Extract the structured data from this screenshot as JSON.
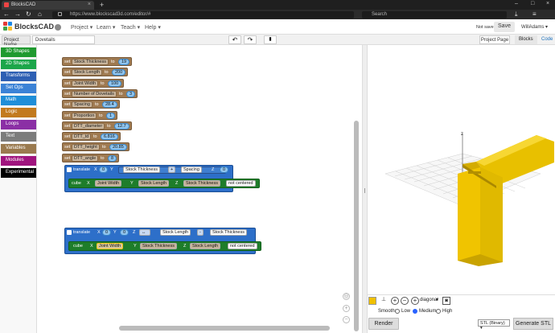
{
  "browser": {
    "tab_title": "BlocksCAD",
    "tab_close": "×",
    "new_tab": "+",
    "url": "https://www.blockscad3d.com/editor/#",
    "search_placeholder": "Search",
    "win_min": "–",
    "win_max": "□",
    "win_close": "×"
  },
  "header": {
    "brand": "BlocksCAD",
    "menu": [
      {
        "label": "Project ▾"
      },
      {
        "label": "Learn ▾"
      },
      {
        "label": "Teach ▾"
      },
      {
        "label": "Help ▾"
      }
    ],
    "status": "Not saved",
    "save_label": "Save",
    "user": "WillAdams ▾"
  },
  "toolbar": {
    "project_name_label": "Project Name",
    "project_name_value": "Dovetails",
    "undo": "↶",
    "redo": "↷",
    "trash": "🗑",
    "project_page": "Project Page",
    "tab_blocks": "Blocks",
    "tab_code": "Code"
  },
  "sidebar": {
    "categories": [
      {
        "label": "3D Shapes",
        "color": "#1f9a2f"
      },
      {
        "label": "2D Shapes",
        "color": "#1ca64a"
      },
      {
        "label": "Transforms",
        "color": "#2d5fb3"
      },
      {
        "label": "Set Ops",
        "color": "#3b82d6"
      },
      {
        "label": "Math",
        "color": "#1f8ed8"
      },
      {
        "label": "Logic",
        "color": "#c27a1e"
      },
      {
        "label": "Loops",
        "color": "#8b2fa5"
      },
      {
        "label": "Text",
        "color": "#7c7c7c"
      },
      {
        "label": "Variables",
        "color": "#9a7a4f"
      },
      {
        "label": "Modules",
        "color": "#a0147e"
      },
      {
        "label": "Experimental",
        "color": "#000000"
      }
    ]
  },
  "blocks": {
    "set_kw": "set",
    "to_kw": "to",
    "vars": [
      {
        "name": "Stock Thickness",
        "value": "19"
      },
      {
        "name": "Stock Length",
        "value": "200"
      },
      {
        "name": "Joint Width",
        "value": "100"
      },
      {
        "name": "Number of Dovetails",
        "value": "3"
      },
      {
        "name": "Spacing",
        "value": "28.4"
      },
      {
        "name": "Proportion",
        "value": "1"
      },
      {
        "name": "DTT_diameter",
        "value": "12.7"
      },
      {
        "name": "DTT_td",
        "value": "6.816"
      },
      {
        "name": "DTT_height",
        "value": "20.85"
      },
      {
        "name": "DTT_angle",
        "value": "8"
      }
    ],
    "translate1": {
      "label": "translate",
      "x_label": "X",
      "x_val": "0",
      "y_label": "Y",
      "y_a": "Stock Thickness",
      "y_op": "+",
      "y_b": "Spacing",
      "z_label": "Z",
      "z_val": "0"
    },
    "cube1": {
      "label": "cube",
      "x_label": "X",
      "x": "Joint Width",
      "y_label": "Y",
      "y": "Stock Length",
      "z_label": "Z",
      "z": "Stock Thickness",
      "mode": "not centered"
    },
    "translate2": {
      "label": "translate",
      "x_label": "X",
      "x_val": "0",
      "y_label": "Y",
      "y_val": "0",
      "z_label": "Z",
      "z_a": "Stock Length",
      "z_op": "-",
      "z_b": "Stock Thickness"
    },
    "cube2": {
      "label": "cube",
      "x_label": "X",
      "x": "Joint Width",
      "y_label": "Y",
      "y": "Stock Thickness",
      "z_label": "Z",
      "z": "Stock Length",
      "mode": "not centered"
    }
  },
  "viewport": {
    "axis_label": "z",
    "view_mode": "diagonal",
    "smooth_label": "Smooth:",
    "smooth_options": [
      "Low",
      "Medium",
      "High"
    ],
    "smooth_selected": "Medium",
    "render_label": "Render",
    "export_format": "STL (Binary) ▾",
    "generate_label": "Generate STL",
    "model_color": "#f0c000"
  }
}
